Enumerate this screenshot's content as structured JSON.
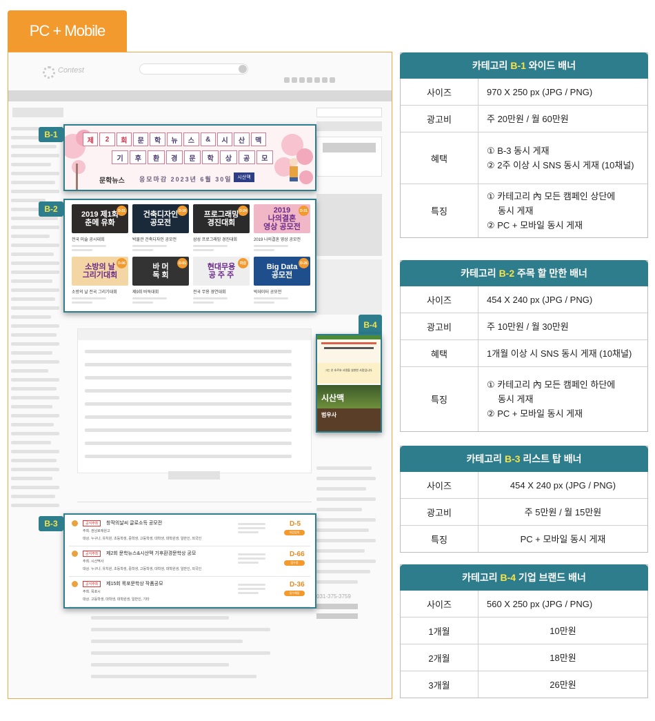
{
  "tab_label": "PC + Mobile",
  "screenshot": {
    "logo": "Contest",
    "labels": [
      "B-1",
      "B-2",
      "B-3",
      "B-4"
    ],
    "b1": {
      "headline_row1": [
        "제",
        "2",
        "회",
        "문",
        "학",
        "뉴",
        "스",
        "&",
        "시",
        "산",
        "맥"
      ],
      "headline_row2": [
        "기",
        "후",
        "환",
        "경",
        "문",
        "학",
        "상",
        "공",
        "모"
      ],
      "brand_left": "문학뉴스",
      "deadline": "응모마감 2023년 6월 30일",
      "brand_right": "시산맥"
    },
    "b2": [
      {
        "img": "2019 제1회\n춘메 유화",
        "bg": "#2f2a2a",
        "title": "전국 미술 공시대회",
        "dday": "D-31"
      },
      {
        "img": "건축디자인\n공모전",
        "bg": "#1a2a3a",
        "title": "박물관 건축디자인 공모전",
        "dday": "D-16"
      },
      {
        "img": "프로그래밍\n경진대회",
        "bg": "#2b2b2b",
        "title": "삼성 프로그래밍 경진대회",
        "dday": "D-24"
      },
      {
        "img": "2019\n나의결혼\n영상 공모전",
        "bg": "#f2b7c7",
        "title": "2019 나의결혼 영상 공모전",
        "dday": "D-31"
      },
      {
        "img": "소방의 날\n그리기대회",
        "bg": "#f4d5a4",
        "title": "소방의 날 전국 그리기대회",
        "dday": "D-06"
      },
      {
        "img": "바 머\n독 회",
        "bg": "#333333",
        "title": "제9회 바둑대회",
        "dday": "D-01"
      },
      {
        "img": "현대무용\n공 주 주",
        "bg": "#eeeeee",
        "title": "전국 무용 경연대회",
        "dday": "마감"
      },
      {
        "img": "Big Data\n공모전",
        "bg": "#1e4e8c",
        "title": "빅데이터 공모전",
        "dday": "D-26"
      }
    ],
    "b3": [
      {
        "tag": "공식주최",
        "title": "창작의날씨 글로소득 공모전",
        "m1": "주최. 권남로애원고",
        "m2": "대상. 누구나, 유치원, 초등학생, 중학생, 고등학생, 대학생, 대학원생, 일반인, 외국인",
        "dday": "D-5",
        "pill": "마감임박"
      },
      {
        "tag": "공식주최",
        "title": "제2회 문학뉴스&시산맥 기후환경문학상 공모",
        "m1": "주최. 시산맥사",
        "m2": "대상. 누구나, 유치원, 초등학생, 중학생, 고등학생, 대학생, 대학원생, 일반인, 외국인",
        "dday": "D-66",
        "pill": "접수중"
      },
      {
        "tag": "공식주최",
        "title": "제15회 목포문학상 작품공모",
        "m1": "주최. 목포시",
        "m2": "대상. 고등학생, 대학생, 대학원생, 일반인, 기타",
        "dday": "D-36",
        "pill": "접수예정"
      }
    ],
    "b4": {
      "mid_text": "그는 온 호르호 사명을 실현한 사람입니다.",
      "brand1": "시산맥",
      "brand2": "범우사"
    },
    "sidebar_phone": "031-375-3759"
  },
  "tables": [
    {
      "title_prefix": "카테고리 ",
      "title_hl": "B-1",
      "title_suffix": " 와이드 배너",
      "rows": [
        {
          "label": "사이즈",
          "lines": [
            "970 X 250 px (JPG / PNG)"
          ]
        },
        {
          "label": "광고비",
          "lines": [
            "주 20만원 / 월 60만원"
          ]
        },
        {
          "label": "혜택",
          "lines": [
            "① B-3 동시 게재",
            "② 2주 이상 시 SNS 동시 게재 (10채널)"
          ]
        },
        {
          "label": "특징",
          "lines": [
            "① 카테고리 內 모든 캠페인 상단에",
            "동시 게재",
            "② PC + 모바일 동시 게재"
          ]
        }
      ]
    },
    {
      "title_prefix": "카테고리 ",
      "title_hl": "B-2",
      "title_suffix": " 주목 할 만한 배너",
      "rows": [
        {
          "label": "사이즈",
          "lines": [
            "454 X 240 px (JPG / PNG)"
          ]
        },
        {
          "label": "광고비",
          "lines": [
            "주 10만원 / 월 30만원"
          ]
        },
        {
          "label": "혜택",
          "lines": [
            "1개월 이상 시 SNS 동시 게재 (10채널)"
          ]
        },
        {
          "label": "특징",
          "lines": [
            "① 카테고리 內 모든 캠페인 하단에",
            "동시 게재",
            "② PC + 모바일 동시 게재"
          ]
        }
      ]
    },
    {
      "title_prefix": "카테고리 ",
      "title_hl": "B-3",
      "title_suffix": " 리스트 탑 배너",
      "rows": [
        {
          "label": "사이즈",
          "lines": [
            "454 X 240 px (JPG / PNG)"
          ]
        },
        {
          "label": "광고비",
          "lines": [
            "주 5만원 / 월 15만원"
          ]
        },
        {
          "label": "특징",
          "lines": [
            "PC + 모바일 동시 게재"
          ]
        }
      ]
    },
    {
      "title_prefix": "카테고리 ",
      "title_hl": "B-4",
      "title_suffix": " 기업 브랜드 배너",
      "rows": [
        {
          "label": "사이즈",
          "lines": [
            "560 X 250 px (JPG / PNG)"
          ]
        },
        {
          "label": "1개월",
          "lines": [
            "10만원"
          ]
        },
        {
          "label": "2개월",
          "lines": [
            "18만원"
          ]
        },
        {
          "label": "3개월",
          "lines": [
            "26만원"
          ]
        }
      ]
    }
  ]
}
